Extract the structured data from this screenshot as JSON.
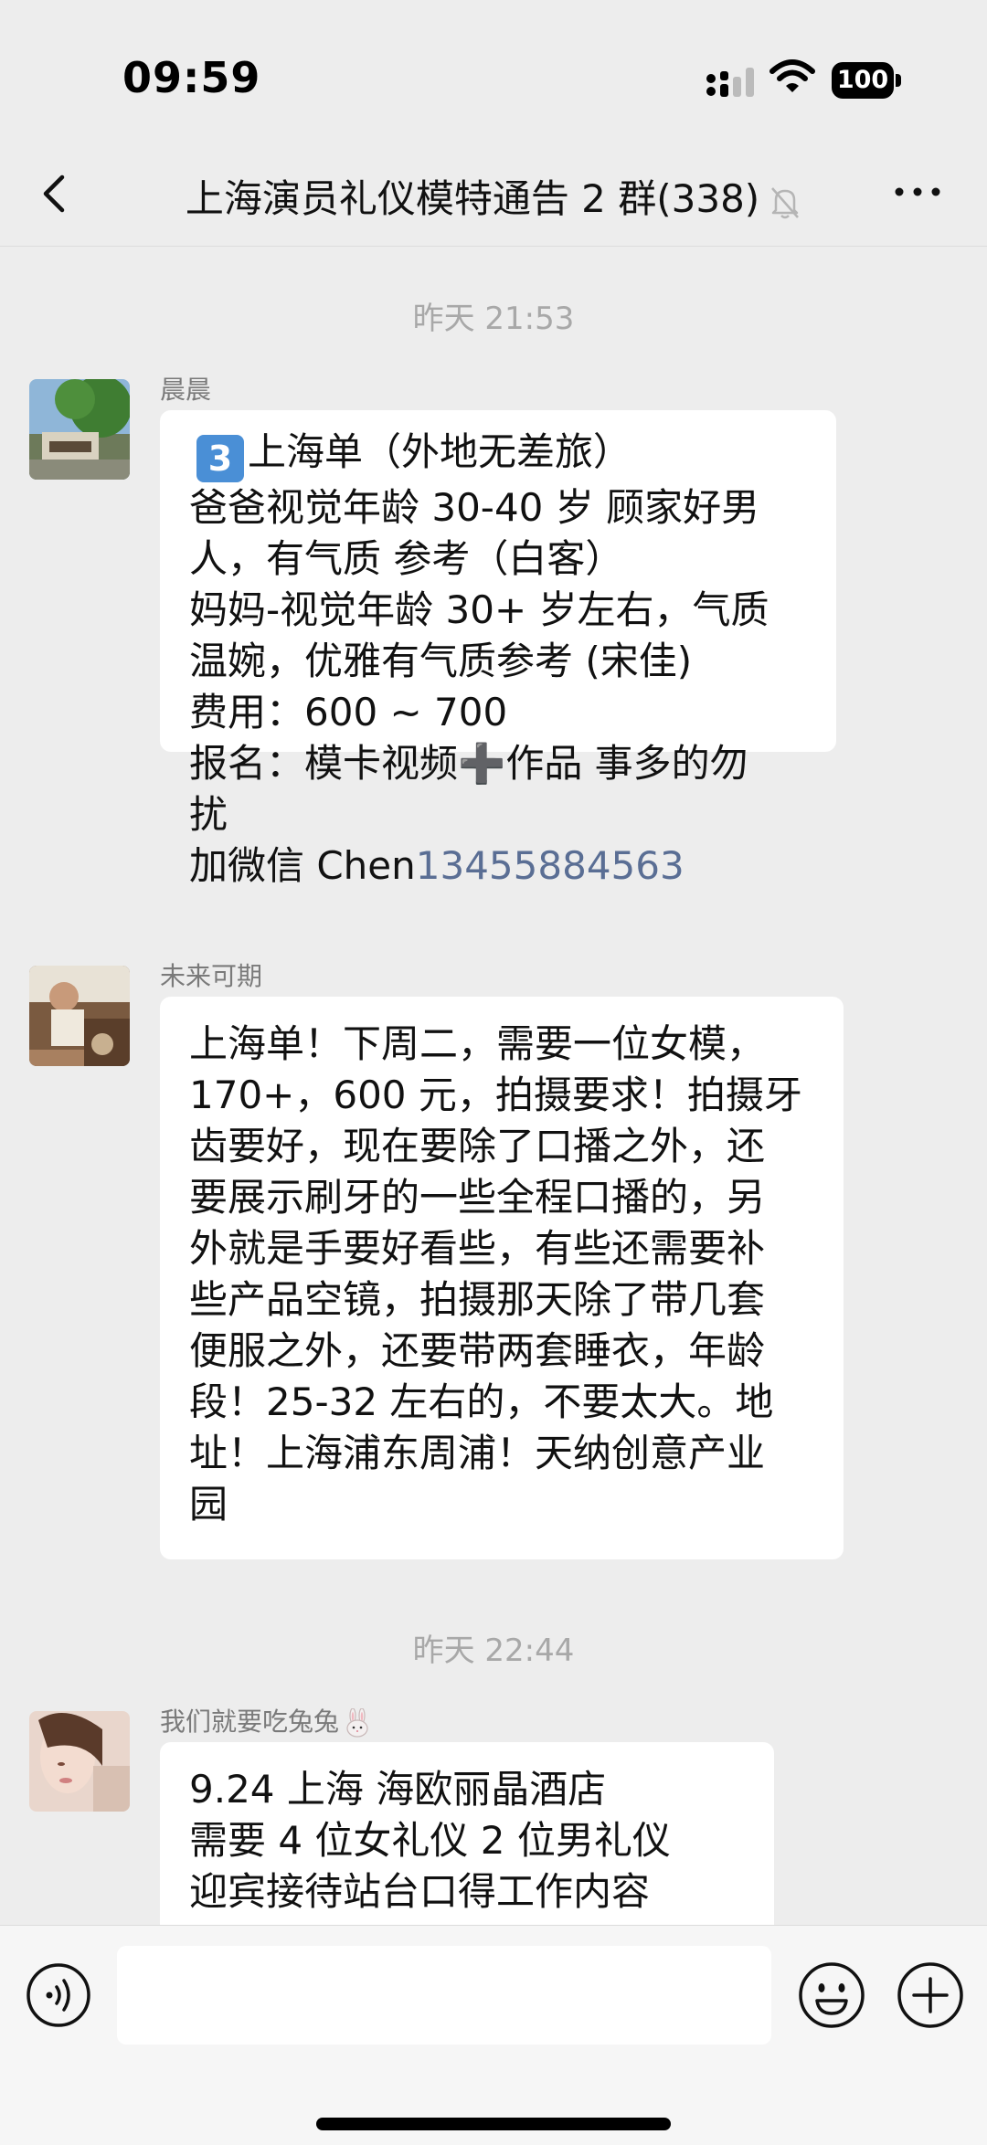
{
  "status_bar": {
    "time": "09:59",
    "battery": "100"
  },
  "nav": {
    "title": "上海演员礼仪模特通告 2 群(338)"
  },
  "messages": [
    {
      "timestamp": "昨天 21:53",
      "sender": "晨晨",
      "lines": {
        "keycap": "3",
        "l1": "上海单（外地无差旅）",
        "l2": "爸爸视觉年龄 30-40 岁   顾家好男",
        "l3": "人，有气质 参考（白客）",
        "l4": "妈妈-视觉年龄 30+ 岁左右，气质",
        "l5": "温婉，优雅有气质参考 (宋佳)",
        "l6": "费用：600 ~ 700",
        "l7a": "报名：模卡视频",
        "l7plus": "➕",
        "l7b": "作品 事多的勿",
        "l8": "扰",
        "l9a": "加微信 Chen",
        "l9phone": "13455884563"
      }
    },
    {
      "sender": "未来可期",
      "lines": [
        "上海单！下周二，需要一位女模，",
        "170+，600 元，拍摄要求！拍摄牙",
        "齿要好，现在要除了口播之外，还",
        "要展示刷牙的一些全程口播的，另",
        "外就是手要好看些，有些还需要补",
        "些产品空镜，拍摄那天除了带几套",
        "便服之外，还要带两套睡衣，年龄",
        "段！25-32 左右的，不要太大。地",
        "址！上海浦东周浦！天纳创意产业",
        "园"
      ]
    },
    {
      "timestamp": "昨天 22:44",
      "sender": "我们就要吃兔兔",
      "sender_icon": "rabbit-icon",
      "lines": [
        "9.24 上海 海欧丽晶酒店",
        "需要 4 位女礼仪 2 位男礼仪",
        "迎宾接待站台口得工作内容"
      ]
    }
  ],
  "input_bar": {
    "placeholder": ""
  },
  "colors": {
    "background": "#ededed",
    "bubble": "#ffffff",
    "link": "#5a6e94",
    "timestamp": "#a8a8a8",
    "sender": "#7a7a7a"
  }
}
